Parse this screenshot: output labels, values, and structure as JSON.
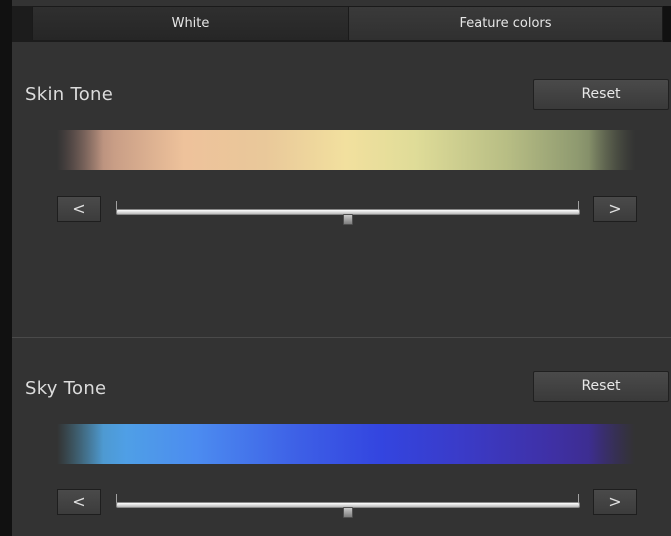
{
  "tabs": {
    "white_label": "White",
    "feature_label": "Feature colors"
  },
  "skin": {
    "title": "Skin Tone",
    "reset_label": "Reset",
    "left_arrow": "<",
    "right_arrow": ">",
    "slider_value": 0.5
  },
  "sky": {
    "title": "Sky Tone",
    "reset_label": "Reset",
    "left_arrow": "<",
    "right_arrow": ">",
    "slider_value": 0.5
  },
  "colors": {
    "panel_bg": "#333333",
    "tab_bar_bg": "#1c1c1c",
    "button_bg": "#424242"
  }
}
